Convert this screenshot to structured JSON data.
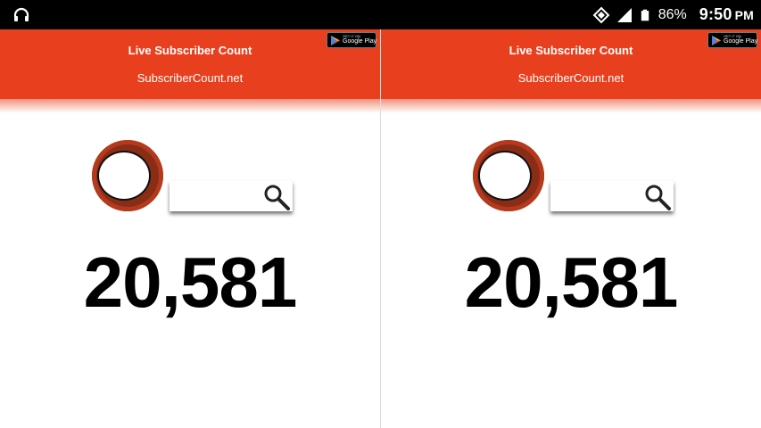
{
  "status_bar": {
    "battery_percent": "86%",
    "time": "9:50",
    "ampm": "PM",
    "left_icon": "headset-icon",
    "icons": [
      "data-saver-icon",
      "signal-icon",
      "battery-icon"
    ]
  },
  "panels": [
    {
      "header": {
        "title": "Live Subscriber Count",
        "subtitle": "SubscriberCount.net"
      },
      "play_badge": {
        "small": "GET IT ON",
        "label": "Google Play"
      },
      "count": "20,581"
    },
    {
      "header": {
        "title": "Live Subscriber Count",
        "subtitle": "SubscriberCount.net"
      },
      "play_badge": {
        "small": "GET IT ON",
        "label": "Google Play"
      },
      "count": "20,581"
    }
  ],
  "colors": {
    "header": "#e8401f",
    "count_text": "#000000",
    "status_bar": "#000000"
  }
}
